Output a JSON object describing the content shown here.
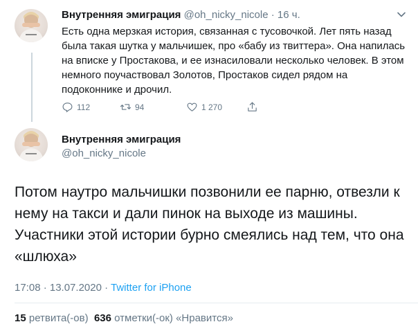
{
  "tweet1": {
    "author_name": "Внутренняя эмиграция",
    "handle": "@oh_nicky_nicole",
    "separator": "·",
    "time_ago": "16 ч.",
    "text": "Есть одна мерзкая история, связанная с тусовочкой. Лет пять назад была такая шутка у мальчишек, про «бабу из твиттера». Она напилась на вписке у Простакова, и ее изнасиловали несколько человек. В этом немного поучаствовал Золотов, Простаков сидел рядом на подоконнике и дрочил.",
    "actions": {
      "replies": "112",
      "retweets": "94",
      "likes": "1 270"
    },
    "icons": [
      "reply-icon",
      "retweet-icon",
      "like-icon",
      "share-icon",
      "chevron-down-icon"
    ]
  },
  "tweet2": {
    "author_name": "Внутренняя эмиграция",
    "handle": "@oh_nicky_nicole",
    "text": "Потом наутро мальчишки позвонили ее парню, отвезли к нему на такси и дали пинок на выходе из машины. Участники этой истории бурно смеялись над тем, что она «шлюха»",
    "timestamp": "17:08 · 13.07.2020 ·",
    "source": "Twitter for iPhone",
    "stats": {
      "retweets_count": "15",
      "retweets_label": "ретвита(-ов)",
      "likes_count": "636",
      "likes_label": "отметки(-ок) «Нравится»"
    }
  },
  "colors": {
    "text": "#14171a",
    "secondary": "#657786",
    "link": "#1da1f2",
    "divider": "#e6ecf0",
    "thread_line": "#ccd6dd"
  }
}
